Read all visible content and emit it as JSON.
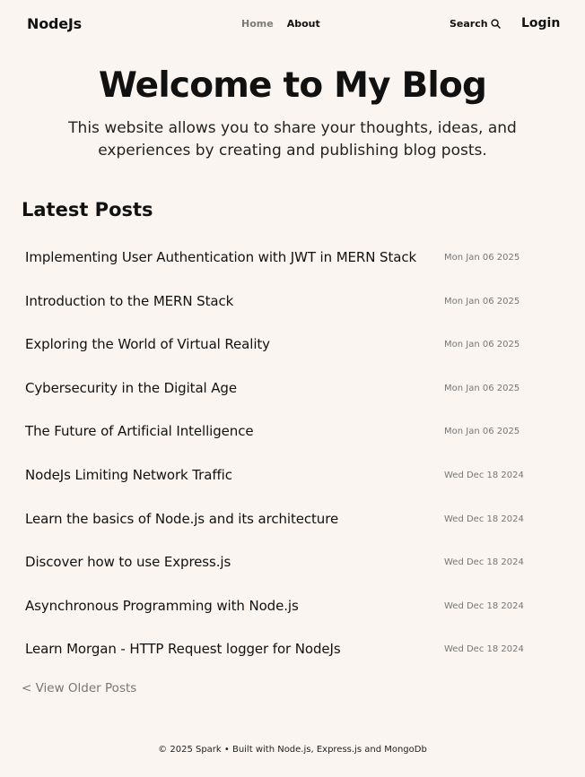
{
  "header": {
    "logo": "NodeJs",
    "nav": {
      "home": "Home",
      "about": "About"
    },
    "search_label": "Search",
    "search_icon": "search-icon",
    "login": "Login"
  },
  "hero": {
    "title": "Welcome to My Blog",
    "subtitle": "This website allows you to share your thoughts, ideas, and experiences by creating and publishing blog posts."
  },
  "latest": {
    "heading": "Latest Posts",
    "posts": [
      {
        "title": "Implementing User Authentication with JWT in MERN Stack",
        "date": "Mon Jan 06 2025"
      },
      {
        "title": "Introduction to the MERN Stack",
        "date": "Mon Jan 06 2025"
      },
      {
        "title": "Exploring the World of Virtual Reality",
        "date": "Mon Jan 06 2025"
      },
      {
        "title": "Cybersecurity in the Digital Age",
        "date": "Mon Jan 06 2025"
      },
      {
        "title": "The Future of Artificial Intelligence",
        "date": "Mon Jan 06 2025"
      },
      {
        "title": "NodeJs Limiting Network Traffic",
        "date": "Wed Dec 18 2024"
      },
      {
        "title": "Learn the basics of Node.js and its architecture",
        "date": "Wed Dec 18 2024"
      },
      {
        "title": "Discover how to use Express.js",
        "date": "Wed Dec 18 2024"
      },
      {
        "title": "Asynchronous Programming with Node.js",
        "date": "Wed Dec 18 2024"
      },
      {
        "title": "Learn Morgan - HTTP Request logger for NodeJs",
        "date": "Wed Dec 18 2024"
      }
    ],
    "older_link": "< View Older Posts"
  },
  "footer": {
    "text": "© 2025 Spark • Built with Node.js, Express.js and MongoDb"
  },
  "colors": {
    "background": "#faf5f0",
    "text": "#111111",
    "muted": "#777777"
  }
}
